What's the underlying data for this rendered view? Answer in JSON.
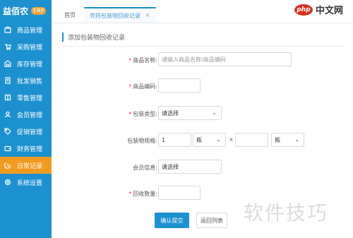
{
  "brand": {
    "name": "益佰农",
    "badge": "ERP"
  },
  "sidebar": {
    "items": [
      {
        "label": "商品管理",
        "icon": "box-icon"
      },
      {
        "label": "采购管理",
        "icon": "cart-icon"
      },
      {
        "label": "库存管理",
        "icon": "warehouse-icon"
      },
      {
        "label": "批发销售",
        "icon": "document-icon"
      },
      {
        "label": "零售管理",
        "icon": "ledger-icon"
      },
      {
        "label": "会员管理",
        "icon": "user-icon"
      },
      {
        "label": "促销管理",
        "icon": "tag-icon"
      },
      {
        "label": "财务管理",
        "icon": "wallet-icon"
      },
      {
        "label": "日常记录",
        "icon": "record-icon",
        "active": true
      },
      {
        "label": "系统设置",
        "icon": "gear-icon"
      }
    ]
  },
  "tabs": {
    "home": "首页",
    "active": "农药包装物回收记录",
    "close": "×"
  },
  "php_logo": {
    "oval": "php",
    "text": "中文网"
  },
  "watermark": "软件技巧",
  "form": {
    "section_title": "添加包装物回收记录",
    "fields": {
      "product_name": {
        "label": "商品名称:",
        "placeholder": "请输入商品名称/商品编码"
      },
      "product_barcode": {
        "label": "商品编码:",
        "value": ""
      },
      "pack_type": {
        "label": "包装类型:",
        "value": "请选择"
      },
      "pack_spec": {
        "label": "包装物规格:",
        "value1": "1",
        "unit1": "瓶",
        "separator": "×",
        "value2": "",
        "unit2": "瓶"
      },
      "member_info": {
        "label": "会员信息:",
        "value": "请选择"
      },
      "recycle_qty": {
        "label": "回收数量:",
        "value": ""
      }
    },
    "buttons": {
      "confirm": "确认提交",
      "back": "返回列表"
    }
  }
}
